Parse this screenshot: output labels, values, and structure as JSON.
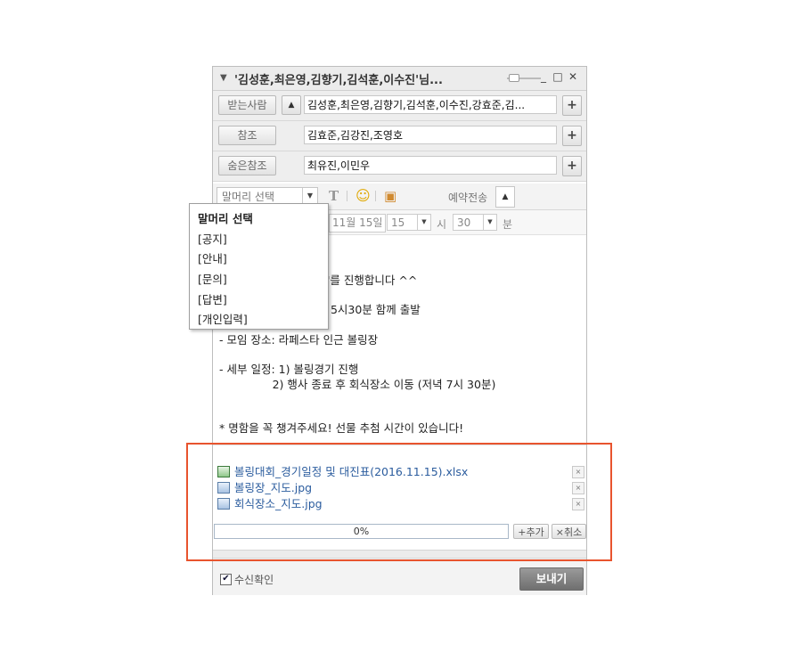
{
  "window": {
    "title": "'김성훈,최은영,김향기,김석훈,이수진'님...",
    "controls": {
      "minimize": "_",
      "maximize": "□",
      "close": "✕"
    }
  },
  "recipients": {
    "to_label": "받는사람",
    "to_value": "김성훈,최은영,김향기,김석훈,이수진,강효준,김...",
    "cc_label": "참조",
    "cc_value": "김효준,김강진,조영호",
    "bcc_label": "숨은참조",
    "bcc_value": "최유진,이민우",
    "expand_symbol": "▲",
    "add_symbol": "+"
  },
  "toolbar": {
    "header_select": "말머리 선택",
    "dropdown_arrow": "▼",
    "font_icon": "T",
    "emoticon_icon": "☺",
    "image_icon": "▣",
    "reserve_label": "예약전송",
    "reserve_toggle": "▲"
  },
  "schedule": {
    "date": "11월 15일",
    "hour": "15",
    "hour_unit": "시",
    "minute": "30",
    "minute_unit": "분"
  },
  "header_menu": {
    "items": [
      "말머리 선택",
      "[공지]",
      "[안내]",
      "[문의]",
      "[답변]",
      "[개인입력]"
    ]
  },
  "message": {
    "lines": [
      "경기'를 진행합니다 ^^",
      "오후 5시30분 함께 출발",
      "- 모임 장소: 라페스타 인근 볼링장",
      "- 세부 일정: 1) 볼링경기 진행",
      "               2) 행사 종료 후 회식장소 이동 (저녁 7시 30분)",
      "* 명함을 꼭 챙겨주세요! 선물 추첨 시간이 있습니다!"
    ]
  },
  "attachments": {
    "files": [
      {
        "name": "볼링대회_경기일정 및 대진표(2016.11.15).xlsx",
        "icon": "excel-file-icon"
      },
      {
        "name": "볼링장_지도.jpg",
        "icon": "image-file-icon"
      },
      {
        "name": "회식장소_지도.jpg",
        "icon": "image-file-icon"
      }
    ],
    "delete_symbol": "×",
    "progress": 0,
    "progress_text": "0%",
    "add_label": "+추가",
    "cancel_label": "×취소"
  },
  "footer": {
    "read_receipt_label": "수신확인",
    "read_receipt_checked": true,
    "check_mark": "✔",
    "send_label": "보내기"
  },
  "colors": {
    "highlight": "#e8542e",
    "link": "#2b5c9e",
    "send_button": "#7f7f7f"
  }
}
